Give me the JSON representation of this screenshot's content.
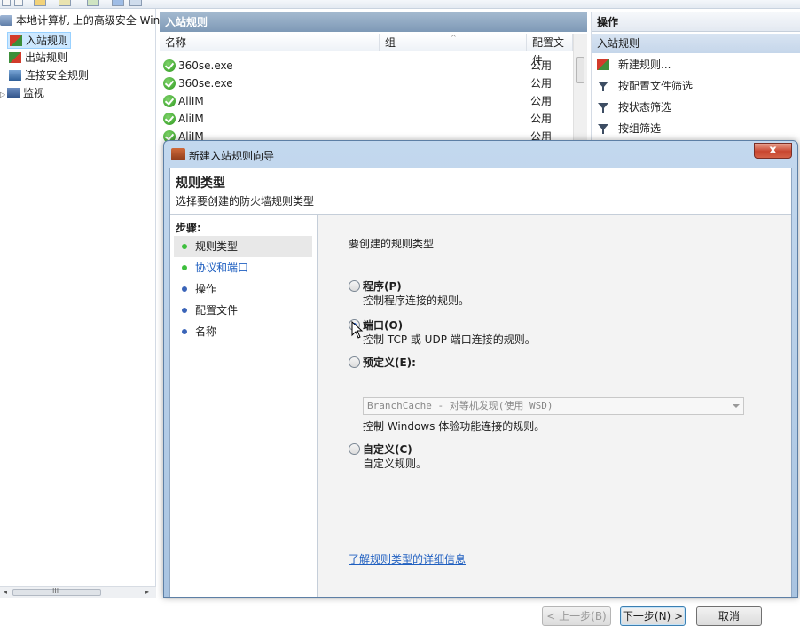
{
  "tree": {
    "root": "本地计算机 上的高级安全 Win",
    "items": [
      "入站规则",
      "出站规则",
      "连接安全规则",
      "监视"
    ],
    "scroll_label": "III"
  },
  "rules": {
    "header": "入站规则",
    "columns": [
      "名称",
      "组",
      "配置文件"
    ],
    "rows": [
      {
        "name": "360se.exe",
        "profile": "公用"
      },
      {
        "name": "360se.exe",
        "profile": "公用"
      },
      {
        "name": "AliIM",
        "profile": "公用"
      },
      {
        "name": "AliIM",
        "profile": "公用"
      },
      {
        "name": "AliIM",
        "profile": "公用"
      }
    ]
  },
  "actions": {
    "header": "操作",
    "sub": "入站规则",
    "items": [
      "新建规则...",
      "按配置文件筛选",
      "按状态筛选",
      "按组筛选"
    ]
  },
  "wizard": {
    "title": "新建入站规则向导",
    "close": "x",
    "heading": "规则类型",
    "subheading": "选择要创建的防火墙规则类型",
    "steps_label": "步骤:",
    "steps": [
      "规则类型",
      "协议和端口",
      "操作",
      "配置文件",
      "名称"
    ],
    "question": "要创建的规则类型",
    "options": [
      {
        "title": "程序(P)",
        "desc": "控制程序连接的规则。"
      },
      {
        "title": "端口(O)",
        "desc": "控制 TCP 或 UDP 端口连接的规则。"
      },
      {
        "title": "预定义(E):",
        "desc": "控制 Windows 体验功能连接的规则。"
      },
      {
        "title": "自定义(C)",
        "desc": "自定义规则。"
      }
    ],
    "predefined_value": "BranchCache - 对等机发现(使用 WSD)",
    "selected_option": 1,
    "learn_more": "了解规则类型的详细信息",
    "buttons": {
      "back": "< 上一步(B)",
      "next": "下一步(N) >",
      "cancel": "取消"
    }
  }
}
